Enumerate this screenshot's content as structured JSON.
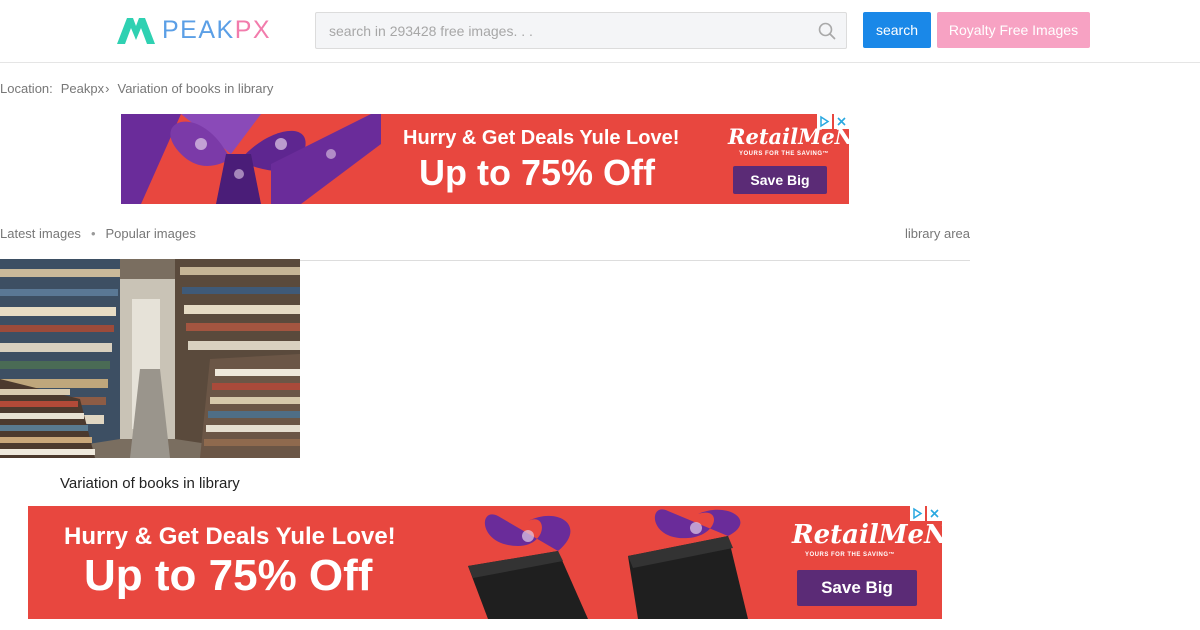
{
  "header": {
    "logo": {
      "text_pe": "PEAK",
      "text_px": "PX",
      "icon": "peakpx-mountain-logo"
    },
    "search": {
      "placeholder": "search in 293428 free images. . .",
      "icon": "search-icon"
    },
    "search_button_label": "search",
    "royalty_button_label": "Royalty Free Images"
  },
  "breadcrumb": {
    "prefix": "Location:",
    "items": [
      {
        "label": "Peakpx"
      },
      {
        "label": "Variation of books in library"
      }
    ],
    "separator": "›"
  },
  "ads": [
    {
      "headline_top": "Hurry & Get Deals Yule Love!",
      "headline_big": "Up to 75% Off",
      "brand": "RetailMeNot",
      "tagline": "YOURS FOR THE SAVING™",
      "cta": "Save Big"
    },
    {
      "headline_top": "Hurry & Get Deals Yule Love!",
      "headline_big": "Up to 75% Off",
      "brand": "RetailMeNot",
      "tagline": "YOURS FOR THE SAVING™",
      "cta": "Save Big"
    }
  ],
  "tabs": {
    "latest": "Latest images",
    "separator": "•",
    "popular": "Popular images",
    "tag": "library area"
  },
  "image_card": {
    "caption": "Variation of books in library",
    "image": "bookstore-aisle-photo"
  },
  "colors": {
    "search_button": "#1a88e8",
    "royalty_button": "#f7a2c3",
    "ad_background": "#e8473f",
    "ad_cta": "#5b2b76",
    "logo_teal": "#2fd1b2",
    "logo_blue": "#5b9fe6",
    "logo_pink": "#f27cac"
  }
}
